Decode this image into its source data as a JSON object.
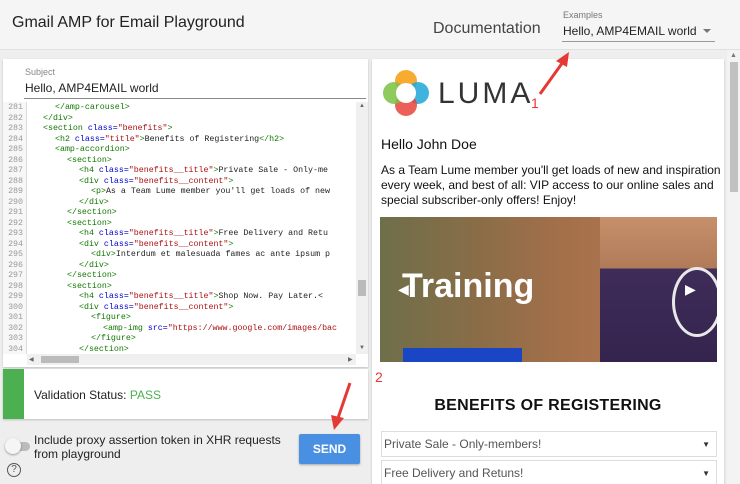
{
  "header": {
    "title": "Gmail AMP for Email Playground",
    "documentation_label": "Documentation",
    "examples_label": "Examples",
    "examples_value": "Hello, AMP4EMAIL world"
  },
  "subject": {
    "label": "Subject",
    "value": "Hello, AMP4EMAIL world"
  },
  "editor": {
    "lines": [
      {
        "n": "281",
        "indent": 2,
        "parts": [
          [
            "t",
            "</amp-carousel>"
          ]
        ]
      },
      {
        "n": "282",
        "indent": 1,
        "parts": [
          [
            "t",
            "</div>"
          ]
        ]
      },
      {
        "n": "283",
        "indent": 1,
        "parts": [
          [
            "t",
            "<section "
          ],
          [
            "a",
            "class="
          ],
          [
            "s",
            "\"benefits\""
          ],
          [
            "t",
            ">"
          ]
        ]
      },
      {
        "n": "284",
        "indent": 2,
        "parts": [
          [
            "t",
            "<h2 "
          ],
          [
            "a",
            "class="
          ],
          [
            "s",
            "\"title\""
          ],
          [
            "t",
            ">"
          ],
          [
            "p",
            "Benefits of Registering"
          ],
          [
            "t",
            "</h2>"
          ]
        ]
      },
      {
        "n": "285",
        "indent": 2,
        "parts": [
          [
            "t",
            "<amp-accordion>"
          ]
        ]
      },
      {
        "n": "286",
        "indent": 3,
        "parts": [
          [
            "t",
            "<section>"
          ]
        ]
      },
      {
        "n": "287",
        "indent": 4,
        "parts": [
          [
            "t",
            "<h4 "
          ],
          [
            "a",
            "class="
          ],
          [
            "s",
            "\"benefits__title\""
          ],
          [
            "t",
            ">"
          ],
          [
            "p",
            "Private Sale - Only-me"
          ]
        ]
      },
      {
        "n": "288",
        "indent": 4,
        "parts": [
          [
            "t",
            "<div "
          ],
          [
            "a",
            "class="
          ],
          [
            "s",
            "\"benefits__content\""
          ],
          [
            "t",
            ">"
          ]
        ]
      },
      {
        "n": "289",
        "indent": 5,
        "parts": [
          [
            "t",
            "<p>"
          ],
          [
            "p",
            "As a Team Lume member you'll get loads of new"
          ]
        ]
      },
      {
        "n": "290",
        "indent": 4,
        "parts": [
          [
            "t",
            "</div>"
          ]
        ]
      },
      {
        "n": "291",
        "indent": 3,
        "parts": [
          [
            "t",
            "</section>"
          ]
        ]
      },
      {
        "n": "292",
        "indent": 3,
        "parts": [
          [
            "t",
            "<section>"
          ]
        ]
      },
      {
        "n": "293",
        "indent": 4,
        "parts": [
          [
            "t",
            "<h4 "
          ],
          [
            "a",
            "class="
          ],
          [
            "s",
            "\"benefits__title\""
          ],
          [
            "t",
            ">"
          ],
          [
            "p",
            "Free Delivery and Retu"
          ]
        ]
      },
      {
        "n": "294",
        "indent": 4,
        "parts": [
          [
            "t",
            "<div "
          ],
          [
            "a",
            "class="
          ],
          [
            "s",
            "\"benefits__content\""
          ],
          [
            "t",
            ">"
          ]
        ]
      },
      {
        "n": "295",
        "indent": 5,
        "parts": [
          [
            "t",
            "<div>"
          ],
          [
            "p",
            "Interdum et malesuada fames ac ante ipsum p"
          ]
        ]
      },
      {
        "n": "296",
        "indent": 4,
        "parts": [
          [
            "t",
            "</div>"
          ]
        ]
      },
      {
        "n": "297",
        "indent": 3,
        "parts": [
          [
            "t",
            "</section>"
          ]
        ]
      },
      {
        "n": "298",
        "indent": 3,
        "parts": [
          [
            "t",
            "<section>"
          ]
        ]
      },
      {
        "n": "299",
        "indent": 4,
        "parts": [
          [
            "t",
            "<h4 "
          ],
          [
            "a",
            "class="
          ],
          [
            "s",
            "\"benefits__title\""
          ],
          [
            "t",
            ">"
          ],
          [
            "p",
            "Shop Now. Pay Later.<"
          ]
        ]
      },
      {
        "n": "300",
        "indent": 4,
        "parts": [
          [
            "t",
            "<div "
          ],
          [
            "a",
            "class="
          ],
          [
            "s",
            "\"benefits__content\""
          ],
          [
            "t",
            ">"
          ]
        ]
      },
      {
        "n": "301",
        "indent": 5,
        "parts": [
          [
            "t",
            "<figure>"
          ]
        ]
      },
      {
        "n": "302",
        "indent": 6,
        "parts": [
          [
            "t",
            "<amp-img "
          ],
          [
            "a",
            "src="
          ],
          [
            "s",
            "\"https://www.google.com/images/bac"
          ]
        ]
      },
      {
        "n": "303",
        "indent": 5,
        "parts": [
          [
            "t",
            "</figure>"
          ]
        ]
      },
      {
        "n": "304",
        "indent": 4,
        "parts": [
          [
            "t",
            "</section>"
          ]
        ]
      }
    ]
  },
  "validation": {
    "label": "Validation Status: ",
    "status": "PASS",
    "status_color": "#4caf50"
  },
  "proxy": {
    "text": "Include proxy assertion token in XHR requests from playground",
    "enabled": false
  },
  "send_label": "SEND",
  "help_glyph": "?",
  "preview": {
    "brand": "LUMA",
    "greeting": "Hello John Doe",
    "intro": "As a Team Lume member you'll get loads of new and inspiration every week, and best of all: VIP access to our online sales and special subscriber-only offers! Enjoy!",
    "hero_title": "Training",
    "benefits_title": "BENEFITS OF REGISTERING",
    "accordion": [
      "Private Sale - Only-members!",
      "Free Delivery and Retuns!"
    ]
  },
  "annotations": [
    "1",
    "2"
  ],
  "accent_color": "#e53935"
}
